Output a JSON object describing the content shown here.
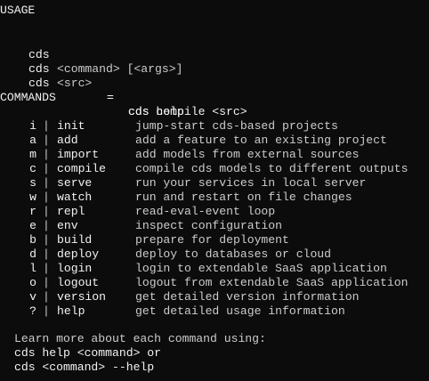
{
  "usage": {
    "heading": "USAGE",
    "lines": [
      {
        "cmd": "cds",
        "rest": "<command> [<args>]",
        "eq": "",
        "rhs": ""
      },
      {
        "cmd": "cds",
        "rest": "<src>",
        "eq": "=",
        "rhs": "cds compile <src>"
      },
      {
        "cmd": "cds",
        "rest": "",
        "eq": "=",
        "rhs": "cds help"
      }
    ]
  },
  "commands": {
    "heading": "COMMANDS",
    "separator": "|",
    "items": [
      {
        "key": "i",
        "name": "init",
        "desc": "jump-start cds-based projects"
      },
      {
        "key": "a",
        "name": "add",
        "desc": "add a feature to an existing project"
      },
      {
        "key": "m",
        "name": "import",
        "desc": "add models from external sources"
      },
      {
        "key": "c",
        "name": "compile",
        "desc": "compile cds models to different outputs"
      },
      {
        "key": "s",
        "name": "serve",
        "desc": "run your services in local server"
      },
      {
        "key": "w",
        "name": "watch",
        "desc": "run and restart on file changes"
      },
      {
        "key": "r",
        "name": "repl",
        "desc": "read-eval-event loop"
      },
      {
        "key": "e",
        "name": "env",
        "desc": "inspect configuration"
      },
      {
        "key": "b",
        "name": "build",
        "desc": "prepare for deployment"
      },
      {
        "key": "d",
        "name": "deploy",
        "desc": "deploy to databases or cloud"
      },
      {
        "key": "l",
        "name": "login",
        "desc": "login to extendable SaaS application"
      },
      {
        "key": "o",
        "name": "logout",
        "desc": "logout from extendable SaaS application"
      },
      {
        "key": "v",
        "name": "version",
        "desc": "get detailed version information"
      },
      {
        "key": "?",
        "name": "help",
        "desc": "get detailed usage information"
      }
    ]
  },
  "footer": {
    "intro": "Learn more about each command using:",
    "line1": "cds help <command> or",
    "line2": "cds <command> --help"
  },
  "colors": {
    "background": "#0c0c0c",
    "text": "#cccccc",
    "bright": "#f2f2f2"
  }
}
